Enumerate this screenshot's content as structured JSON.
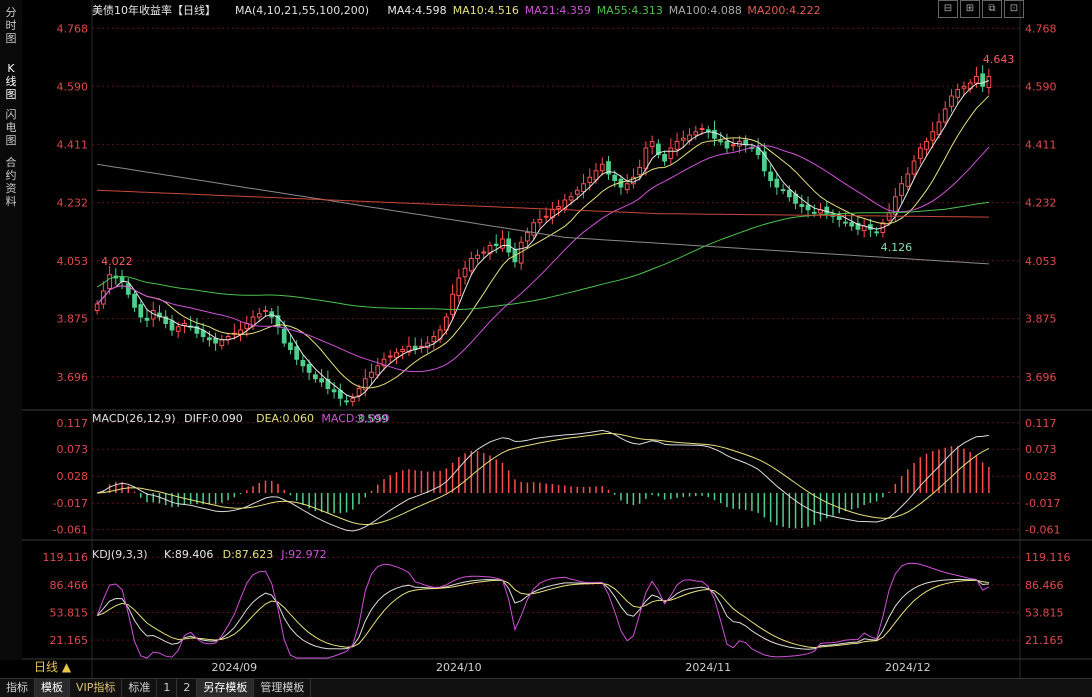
{
  "left_tabs": [
    {
      "label": "分时图",
      "active": false
    },
    {
      "label": "K线图",
      "active": true
    },
    {
      "label": "闪电图",
      "active": false
    },
    {
      "label": "合约资料",
      "active": false
    }
  ],
  "window_buttons": [
    "⊟",
    "⊞",
    "⧉",
    "⊡"
  ],
  "header": {
    "title": "美债10年收益率【日线】",
    "ma_label": "MA(4,10,21,55,100,200)",
    "ma4": "MA4:4.598",
    "ma10": "MA10:4.516",
    "ma21": "MA21:4.359",
    "ma55": "MA55:4.313",
    "ma100": "MA100:4.088",
    "ma200": "MA200:4.222"
  },
  "macd_header": {
    "label": "MACD(26,12,9)",
    "diff": "DIFF:0.090",
    "dea": "DEA:0.060",
    "macd": "MACD:0.059"
  },
  "kdj_header": {
    "label": "KDJ(9,3,3)",
    "k": "K:89.406",
    "d": "D:87.623",
    "j": "J:92.972"
  },
  "colors": {
    "up": "#ff4d4d",
    "down": "#4ecf8c",
    "ma4": "#e8e8e8",
    "ma10": "#e6e07a",
    "ma21": "#d050d8",
    "ma55": "#4cc24c",
    "ma100": "#8a8a8a",
    "ma200": "#c8483c",
    "grid": "#5a1414",
    "axis": "#e04848"
  },
  "price_axis": [
    "4.768",
    "4.590",
    "4.411",
    "4.232",
    "4.053",
    "3.875",
    "3.696"
  ],
  "macd_axis": [
    "0.117",
    "0.073",
    "0.028",
    "-0.017",
    "-0.061"
  ],
  "kdj_axis": [
    "119.116",
    "86.466",
    "53.815",
    "21.165"
  ],
  "date_axis": [
    "2024/09",
    "2024/10",
    "2024/11",
    "2024/12"
  ],
  "period_label": "日线 ▲",
  "annotations": [
    {
      "text": "4.022",
      "value": 4.022,
      "index": 0
    },
    {
      "text": "3.599",
      "value": 3.599,
      "index": 41
    },
    {
      "text": "4.126",
      "value": 4.126,
      "index": 125
    },
    {
      "text": "4.643",
      "value": 4.643,
      "index": 143
    }
  ],
  "toolbar": [
    "指标",
    "模板",
    "VIP指标",
    "标准",
    "1",
    "2",
    "另存模板",
    "管理模板"
  ],
  "chart_data": {
    "type": "candlestick",
    "closes": [
      3.92,
      3.96,
      4.01,
      4.0,
      3.99,
      3.95,
      3.91,
      3.88,
      3.87,
      3.9,
      3.88,
      3.86,
      3.84,
      3.85,
      3.86,
      3.85,
      3.83,
      3.82,
      3.81,
      3.8,
      3.81,
      3.82,
      3.83,
      3.84,
      3.86,
      3.88,
      3.89,
      3.9,
      3.88,
      3.85,
      3.8,
      3.78,
      3.75,
      3.73,
      3.71,
      3.69,
      3.68,
      3.66,
      3.65,
      3.63,
      3.62,
      3.63,
      3.66,
      3.69,
      3.71,
      3.73,
      3.75,
      3.76,
      3.77,
      3.78,
      3.79,
      3.78,
      3.79,
      3.8,
      3.82,
      3.84,
      3.88,
      3.95,
      4.0,
      4.03,
      4.06,
      4.07,
      4.08,
      4.1,
      4.1,
      4.12,
      4.08,
      4.05,
      4.11,
      4.14,
      4.17,
      4.18,
      4.19,
      4.21,
      4.22,
      4.24,
      4.25,
      4.27,
      4.29,
      4.31,
      4.33,
      4.35,
      4.32,
      4.3,
      4.28,
      4.29,
      4.31,
      4.34,
      4.4,
      4.42,
      4.38,
      4.36,
      4.4,
      4.42,
      4.43,
      4.44,
      4.45,
      4.46,
      4.45,
      4.43,
      4.42,
      4.4,
      4.41,
      4.42,
      4.41,
      4.4,
      4.38,
      4.33,
      4.3,
      4.28,
      4.27,
      4.25,
      4.23,
      4.22,
      4.21,
      4.2,
      4.21,
      4.2,
      4.19,
      4.18,
      4.17,
      4.16,
      4.15,
      4.16,
      4.15,
      4.14,
      4.17,
      4.2,
      4.25,
      4.29,
      4.32,
      4.36,
      4.4,
      4.42,
      4.45,
      4.48,
      4.52,
      4.56,
      4.58,
      4.59,
      4.6,
      4.62,
      4.59,
      4.62
    ],
    "ma_lines": [
      "MA4",
      "MA10",
      "MA21",
      "MA55",
      "MA100",
      "MA200"
    ],
    "ylim": [
      3.6,
      4.8
    ],
    "macd_ylim": [
      -0.075,
      0.125
    ],
    "kdj_ylim": [
      0,
      130
    ]
  }
}
